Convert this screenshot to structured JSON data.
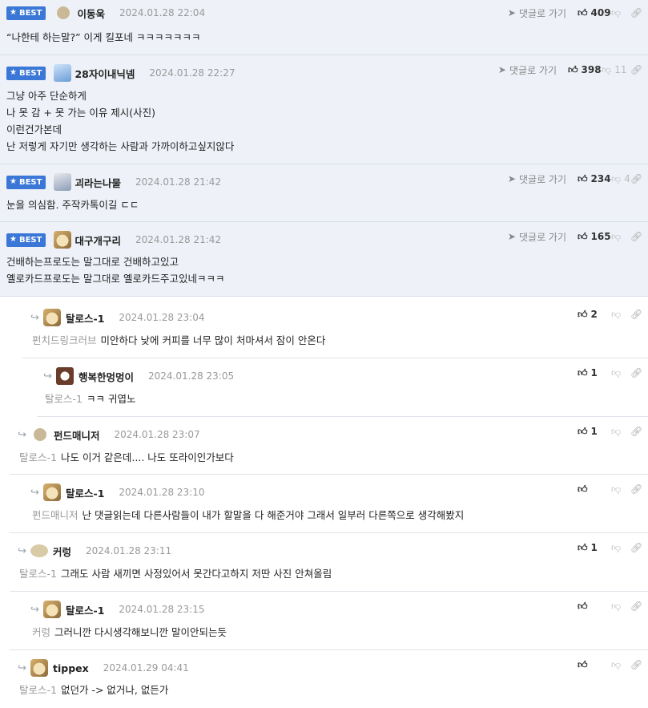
{
  "labels": {
    "best": "BEST",
    "goto": "댓글로 가기"
  },
  "icons": {
    "star": "star-icon",
    "send": "send-icon",
    "thumb_up": "thumbs-up-icon",
    "thumb_down": "thumbs-down-icon",
    "link": "link-icon",
    "reply": "reply-arrow-icon"
  },
  "colors": {
    "best_badge": "#3b77d6",
    "best_bg": "#eef2f8"
  },
  "best_comments": [
    {
      "nick": "이동욱",
      "date": "2024.01.28 22:04",
      "up": "409",
      "down": "",
      "lines": [
        "“나한테 하는말?” 이게 킬포네 ㅋㅋㅋㅋㅋㅋㅋ"
      ]
    },
    {
      "nick": "28자이내닉넴",
      "date": "2024.01.28 22:27",
      "up": "398",
      "down": "11",
      "lines": [
        "그냥 아주 단순하게",
        "나 못 감 + 못 가는 이유 제시(사진)",
        "이런건가본데",
        "난 저렇게 자기만 생각하는 사람과 가까이하고싶지않다"
      ]
    },
    {
      "nick": "괴라는나물",
      "date": "2024.01.28 21:42",
      "up": "234",
      "down": "4",
      "lines": [
        "눈을 의심함. 주작카톡이길 ㄷㄷ"
      ]
    },
    {
      "nick": "대구개구리",
      "date": "2024.01.28 21:42",
      "up": "165",
      "down": "",
      "lines": [
        "건배하는프로도는 말그대로 건배하고있고",
        "옐로카드프로도는 말그대로 옐로카드주고있네ㅋㅋㅋ"
      ]
    }
  ],
  "replies": [
    {
      "nick": "탈로스-1",
      "date": "2024.01.28 23:04",
      "up": "2",
      "mention": "펀치드링크러브",
      "text": "미안하다 낮에 커피를 너무 많이 처마셔서 잠이 안온다"
    },
    {
      "nick": "행복한멍멍이",
      "date": "2024.01.28 23:05",
      "up": "1",
      "mention": "탈로스-1",
      "text": "ㅋㅋ 귀엽노"
    },
    {
      "nick": "펀드매니저",
      "date": "2024.01.28 23:07",
      "up": "1",
      "mention": "탈로스-1",
      "text": "나도 이거 같은데.... 나도 또라이인가보다"
    },
    {
      "nick": "탈로스-1",
      "date": "2024.01.28 23:10",
      "up": "",
      "mention": "펀드매니저",
      "text": "난 댓글읽는데 다른사람들이 내가 할말을 다 해준거야 그래서 일부러 다른쪽으로 생각해봤지"
    },
    {
      "nick": "커렁",
      "date": "2024.01.28 23:11",
      "up": "1",
      "mention": "탈로스-1",
      "text": "그래도 사람 새끼면 사정있어서 못간다고하지 저딴 사진 안쳐올림"
    },
    {
      "nick": "탈로스-1",
      "date": "2024.01.28 23:15",
      "up": "",
      "mention": "커렁",
      "text": "그러니깐 다시생각해보니깐 말이안되는듯"
    },
    {
      "nick": "tippex",
      "date": "2024.01.29 04:41",
      "up": "",
      "mention": "탈로스-1",
      "text": "없던가 -> 없거나, 없든가"
    }
  ]
}
